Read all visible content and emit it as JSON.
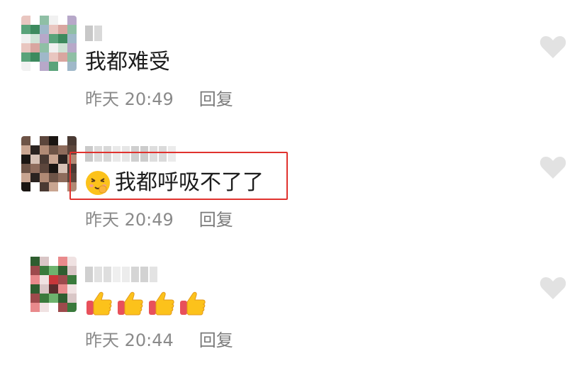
{
  "comments": [
    {
      "text": "我都难受",
      "time": "昨天 20:49",
      "reply": "回复"
    },
    {
      "text": "我都呼吸不了了",
      "emoji": "pinching-face-emoji",
      "time": "昨天 20:49",
      "reply": "回复"
    },
    {
      "text": "",
      "emoji": "thumbs-up-emoji",
      "emoji_count": 4,
      "time": "昨天 20:44",
      "reply": "回复"
    }
  ],
  "colors": {
    "highlight": "#e0322e",
    "meta": "#8a8a8a",
    "like": "#e2e2e2"
  }
}
